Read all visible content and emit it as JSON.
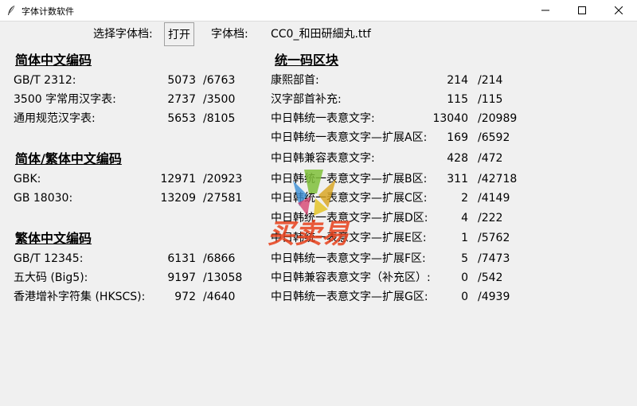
{
  "window": {
    "title": "字体计数软件"
  },
  "toolbar": {
    "select_label": "选择字体档:",
    "open_button": "打开",
    "file_label": "字体档:",
    "file_name": "CC0_和田研細丸.ttf"
  },
  "left_sections": [
    {
      "title": "简体中文编码",
      "rows": [
        {
          "label": "GB/T 2312:",
          "count": "5073",
          "total": "/6763"
        },
        {
          "label": "3500 字常用汉字表:",
          "count": "2737",
          "total": "/3500"
        },
        {
          "label": "通用规范汉字表:",
          "count": "5653",
          "total": "/8105"
        }
      ]
    },
    {
      "title": "简体/繁体中文编码",
      "rows": [
        {
          "label": "GBK:",
          "count": "12971",
          "total": "/20923"
        },
        {
          "label": "GB 18030:",
          "count": "13209",
          "total": "/27581"
        }
      ]
    },
    {
      "title": "繁体中文编码",
      "rows": [
        {
          "label": "GB/T 12345:",
          "count": "6131",
          "total": "/6866"
        },
        {
          "label": "五大码 (Big5):",
          "count": "9197",
          "total": "/13058"
        },
        {
          "label": "香港增补字符集 (HKSCS):",
          "count": "972",
          "total": "/4640"
        }
      ]
    }
  ],
  "right_section": {
    "title": "统一码区块",
    "rows": [
      {
        "label": "康熙部首:",
        "count": "214",
        "total": "/214"
      },
      {
        "label": "汉字部首补充:",
        "count": "115",
        "total": "/115"
      },
      {
        "label": "中日韩统一表意文字:",
        "count": "13040",
        "total": "/20989"
      },
      {
        "label": "中日韩统一表意文字—扩展A区:",
        "count": "169",
        "total": "/6592"
      },
      {
        "label": "中日韩兼容表意文字:",
        "count": "428",
        "total": "/472"
      },
      {
        "label": "中日韩统一表意文字—扩展B区:",
        "count": "311",
        "total": "/42718"
      },
      {
        "label": "中日韩统一表意文字—扩展C区:",
        "count": "2",
        "total": "/4149"
      },
      {
        "label": "中日韩统一表意文字—扩展D区:",
        "count": "4",
        "total": "/222"
      },
      {
        "label": "中日韩统一表意文字—扩展E区:",
        "count": "1",
        "total": "/5762"
      },
      {
        "label": "中日韩统一表意文字—扩展F区:",
        "count": "5",
        "total": "/7473"
      },
      {
        "label": "中日韩兼容表意文字（补充区）:",
        "count": "0",
        "total": "/542"
      },
      {
        "label": "中日韩统一表意文字—扩展G区:",
        "count": "0",
        "total": "/4939"
      }
    ]
  },
  "watermark": {
    "text": "买卖易",
    "icon": "watermark-logo-icon"
  },
  "icons": {
    "app": "feather-icon",
    "minimize": "minimize-icon",
    "maximize": "maximize-icon",
    "close": "close-icon"
  }
}
